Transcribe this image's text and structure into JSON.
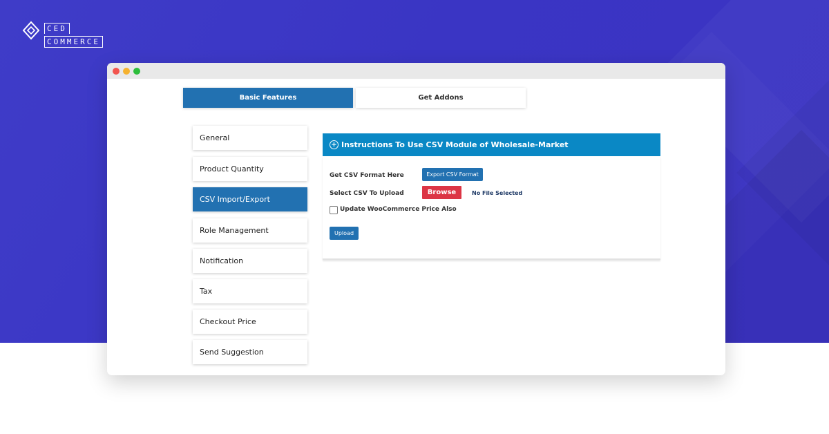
{
  "brand": {
    "line1": "CED",
    "line2": "COMMERCE"
  },
  "tabs": [
    {
      "label": "Basic Features",
      "active": true
    },
    {
      "label": "Get Addons",
      "active": false
    }
  ],
  "sidebar": {
    "items": [
      {
        "label": "General"
      },
      {
        "label": "Product Quantity"
      },
      {
        "label": "CSV Import/Export",
        "active": true
      },
      {
        "label": "Role Management"
      },
      {
        "label": "Notification"
      },
      {
        "label": "Tax"
      },
      {
        "label": "Checkout Price"
      },
      {
        "label": "Send Suggestion"
      }
    ]
  },
  "panel": {
    "header": "Instructions To Use CSV Module of Wholesale-Market",
    "csv_format_label": "Get CSV Format Here",
    "export_button": "Export CSV Format",
    "select_label": "Select CSV To Upload",
    "browse_button": "Browse",
    "no_file": "No File Selected",
    "checkbox_label": "Update WooCommerce Price Also",
    "checkbox_checked": false,
    "upload_button": "Upload"
  },
  "colors": {
    "background": "#3c39c6",
    "accent": "#2271b1",
    "header": "#0a88c5",
    "browse": "#dc3545"
  }
}
